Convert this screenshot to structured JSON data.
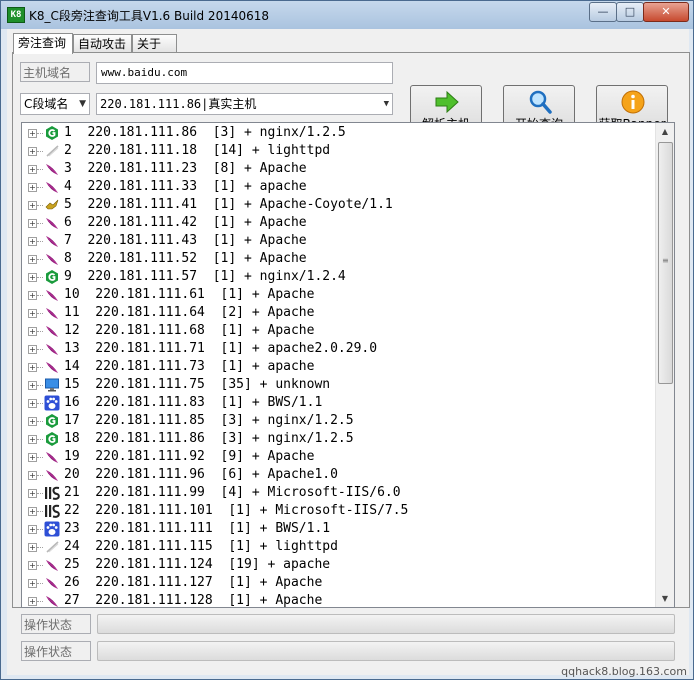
{
  "window": {
    "title": "K8_C段旁注查询工具V1.6  Build 20140618",
    "app_icon_text": "K8",
    "min_glyph": "—",
    "max_glyph": "□",
    "close_glyph": "✕"
  },
  "tabs": [
    {
      "label": "旁注查询",
      "active": true
    },
    {
      "label": "自动攻击",
      "active": false
    },
    {
      "label": "关于",
      "active": false
    }
  ],
  "form": {
    "host_label": "主机域名",
    "host_value": "www.baidu.com",
    "mode_select": "C段域名",
    "ip_select": "220.181.111.86|真实主机"
  },
  "buttons": {
    "resolve_label": "解析主机",
    "query_label": "开始查询",
    "banner_label": "获取Banner"
  },
  "results": [
    {
      "no": "1",
      "ip": "220.181.111.86",
      "count": "[3]",
      "server": "nginx/1.2.5",
      "icon": "nginx-icon"
    },
    {
      "no": "2",
      "ip": "220.181.111.18",
      "count": "[14]",
      "server": "lighttpd",
      "icon": "lighttpd-icon"
    },
    {
      "no": "3",
      "ip": "220.181.111.23",
      "count": "[8]",
      "server": "Apache",
      "icon": "apache-feather-icon"
    },
    {
      "no": "4",
      "ip": "220.181.111.33",
      "count": "[1]",
      "server": "apache",
      "icon": "apache-feather-icon"
    },
    {
      "no": "5",
      "ip": "220.181.111.41",
      "count": "[1]",
      "server": "Apache-Coyote/1.1",
      "icon": "tomcat-icon"
    },
    {
      "no": "6",
      "ip": "220.181.111.42",
      "count": "[1]",
      "server": "Apache",
      "icon": "apache-feather-icon"
    },
    {
      "no": "7",
      "ip": "220.181.111.43",
      "count": "[1]",
      "server": "Apache",
      "icon": "apache-feather-icon"
    },
    {
      "no": "8",
      "ip": "220.181.111.52",
      "count": "[1]",
      "server": "Apache",
      "icon": "apache-feather-icon"
    },
    {
      "no": "9",
      "ip": "220.181.111.57",
      "count": "[1]",
      "server": "nginx/1.2.4",
      "icon": "nginx-icon"
    },
    {
      "no": "10",
      "ip": "220.181.111.61",
      "count": "[1]",
      "server": "Apache",
      "icon": "apache-feather-icon"
    },
    {
      "no": "11",
      "ip": "220.181.111.64",
      "count": "[2]",
      "server": "Apache",
      "icon": "apache-feather-icon"
    },
    {
      "no": "12",
      "ip": "220.181.111.68",
      "count": "[1]",
      "server": "Apache",
      "icon": "apache-feather-icon"
    },
    {
      "no": "13",
      "ip": "220.181.111.71",
      "count": "[1]",
      "server": "apache2.0.29.0",
      "icon": "apache-feather-icon"
    },
    {
      "no": "14",
      "ip": "220.181.111.73",
      "count": "[1]",
      "server": "apache",
      "icon": "apache-feather-icon"
    },
    {
      "no": "15",
      "ip": "220.181.111.75",
      "count": "[35]",
      "server": "unknown",
      "icon": "monitor-icon"
    },
    {
      "no": "16",
      "ip": "220.181.111.83",
      "count": "[1]",
      "server": "BWS/1.1",
      "icon": "baidu-paw-icon"
    },
    {
      "no": "17",
      "ip": "220.181.111.85",
      "count": "[3]",
      "server": "nginx/1.2.5",
      "icon": "nginx-icon"
    },
    {
      "no": "18",
      "ip": "220.181.111.86",
      "count": "[3]",
      "server": "nginx/1.2.5",
      "icon": "nginx-icon"
    },
    {
      "no": "19",
      "ip": "220.181.111.92",
      "count": "[9]",
      "server": "Apache",
      "icon": "apache-feather-icon"
    },
    {
      "no": "20",
      "ip": "220.181.111.96",
      "count": "[6]",
      "server": "Apache1.0",
      "icon": "apache-feather-icon"
    },
    {
      "no": "21",
      "ip": "220.181.111.99",
      "count": "[4]",
      "server": "Microsoft-IIS/6.0",
      "icon": "iis-icon"
    },
    {
      "no": "22",
      "ip": "220.181.111.101",
      "count": "[1]",
      "server": "Microsoft-IIS/7.5",
      "icon": "iis-icon"
    },
    {
      "no": "23",
      "ip": "220.181.111.111",
      "count": "[1]",
      "server": "BWS/1.1",
      "icon": "baidu-paw-icon"
    },
    {
      "no": "24",
      "ip": "220.181.111.115",
      "count": "[1]",
      "server": "lighttpd",
      "icon": "lighttpd-icon"
    },
    {
      "no": "25",
      "ip": "220.181.111.124",
      "count": "[19]",
      "server": "apache",
      "icon": "apache-feather-icon"
    },
    {
      "no": "26",
      "ip": "220.181.111.127",
      "count": "[1]",
      "server": "Apache",
      "icon": "apache-feather-icon"
    },
    {
      "no": "27",
      "ip": "220.181.111.128",
      "count": "[1]",
      "server": "Apache",
      "icon": "apache-feather-icon"
    }
  ],
  "status": [
    {
      "label": "操作状态",
      "progress": 0
    },
    {
      "label": "操作状态",
      "progress": 0
    }
  ],
  "watermark": "qqhack8.blog.163.com",
  "colors": {
    "nginx": "#1a9b3c",
    "apache": "#8b1a7a",
    "baidu": "#2e4fd6",
    "progress_fill": "#06b025"
  }
}
